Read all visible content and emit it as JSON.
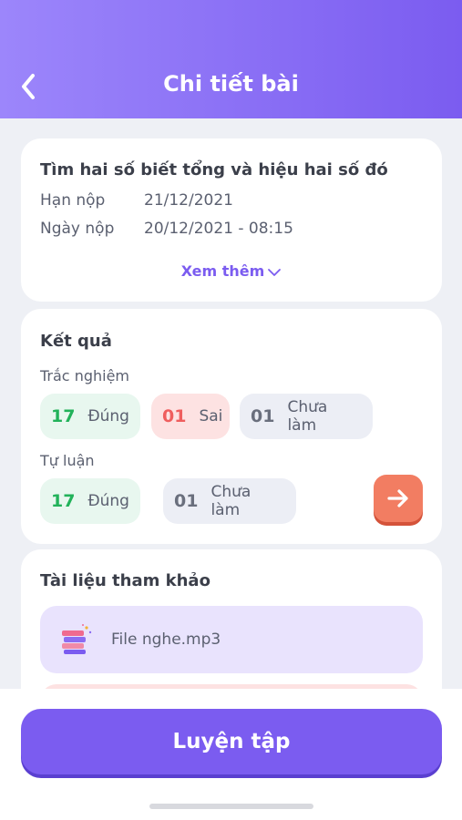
{
  "header": {
    "title": "Chi tiết bài",
    "back_icon": "chevron-left-icon"
  },
  "task": {
    "title": "Tìm hai số biết tổng và hiệu hai số đó",
    "deadline_label": "Hạn nộp",
    "deadline_value": "21/12/2021",
    "submitted_label": "Ngày nộp",
    "submitted_value": "20/12/2021 - 08:15",
    "more_label": "Xem thêm"
  },
  "result": {
    "title": "Kết quả",
    "multiple_choice": {
      "label": "Trắc nghiệm",
      "correct_count": "17",
      "correct_label": "Đúng",
      "wrong_count": "01",
      "wrong_label": "Sai",
      "undone_count": "01",
      "undone_label": "Chưa làm"
    },
    "essay": {
      "label": "Tự luận",
      "correct_count": "17",
      "correct_label": "Đúng",
      "undone_count": "01",
      "undone_label": "Chưa làm"
    }
  },
  "references": {
    "title": "Tài liệu tham khảo",
    "files": [
      {
        "name": "File nghe.mp3",
        "icon": "books-icon"
      }
    ]
  },
  "cta": {
    "label": "Luyện tập"
  },
  "colors": {
    "accent": "#7b5cf0",
    "correct": "#22b25a",
    "wrong": "#ef5e5e",
    "arrow_button": "#f27d62"
  }
}
